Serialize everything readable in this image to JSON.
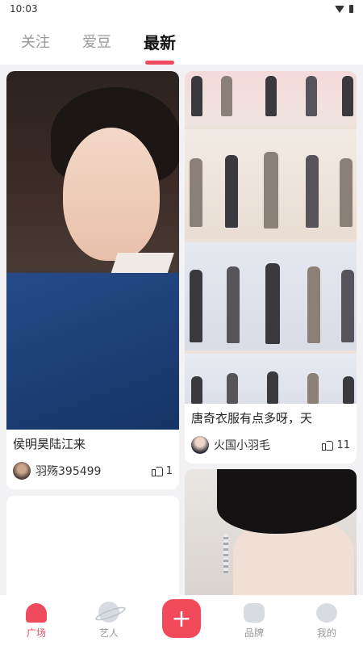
{
  "status_bar": {
    "time": "10:03"
  },
  "top_tabs": [
    {
      "label": "关注",
      "active": false
    },
    {
      "label": "爱豆",
      "active": false
    },
    {
      "label": "最新",
      "active": true
    }
  ],
  "feed": {
    "cards": [
      {
        "title": "侯明昊陆江来",
        "author": "羽殇395499",
        "likes": "1"
      },
      {
        "title": "唐奇衣服有点多呀，天",
        "author": "火国小羽毛",
        "likes": "11"
      }
    ]
  },
  "bottom_nav": {
    "items": [
      {
        "label": "广场",
        "icon": "plaza-icon",
        "active": true
      },
      {
        "label": "艺人",
        "icon": "planet-icon",
        "active": false
      },
      {
        "label": "+",
        "icon": "add-icon",
        "active": false
      },
      {
        "label": "品牌",
        "icon": "brand-icon",
        "active": false
      },
      {
        "label": "我的",
        "icon": "profile-icon",
        "active": false
      }
    ]
  },
  "colors": {
    "accent": "#ef4a5e",
    "background": "#f2f2f4"
  }
}
